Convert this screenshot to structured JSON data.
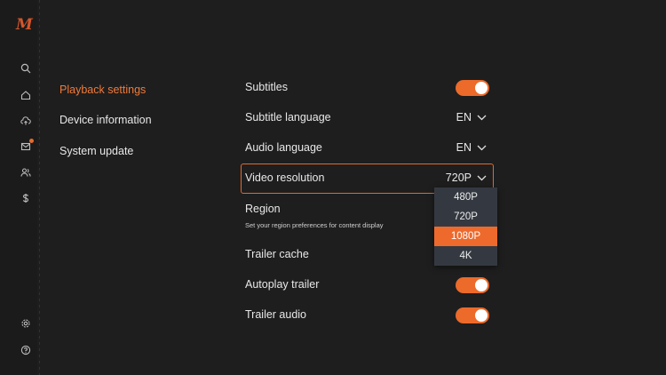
{
  "brand": {
    "logo_text": "M",
    "accent": "#ee6a2c"
  },
  "rail": {
    "icons": [
      "search-icon",
      "home-icon",
      "cloud-upload-icon",
      "mail-icon",
      "users-icon",
      "dollar-icon",
      "gear-icon",
      "help-icon"
    ]
  },
  "menu": {
    "items": [
      {
        "label": "Playback settings",
        "active": true
      },
      {
        "label": "Device information",
        "active": false
      },
      {
        "label": "System update",
        "active": false
      }
    ]
  },
  "settings": {
    "subtitles": {
      "label": "Subtitles",
      "on": true
    },
    "subtitle_language": {
      "label": "Subtitle language",
      "value": "EN"
    },
    "audio_language": {
      "label": "Audio language",
      "value": "EN"
    },
    "video_resolution": {
      "label": "Video resolution",
      "value": "720P"
    },
    "region": {
      "label": "Region",
      "description": "Set your region preferences for content display"
    },
    "trailer_cache": {
      "label": "Trailer cache"
    },
    "autoplay_trailer": {
      "label": "Autoplay trailer",
      "on": true
    },
    "trailer_audio": {
      "label": "Trailer audio",
      "on": true
    }
  },
  "resolution_dropdown": {
    "options": [
      "480P",
      "720P",
      "1080P",
      "4K"
    ],
    "highlighted": "1080P"
  }
}
